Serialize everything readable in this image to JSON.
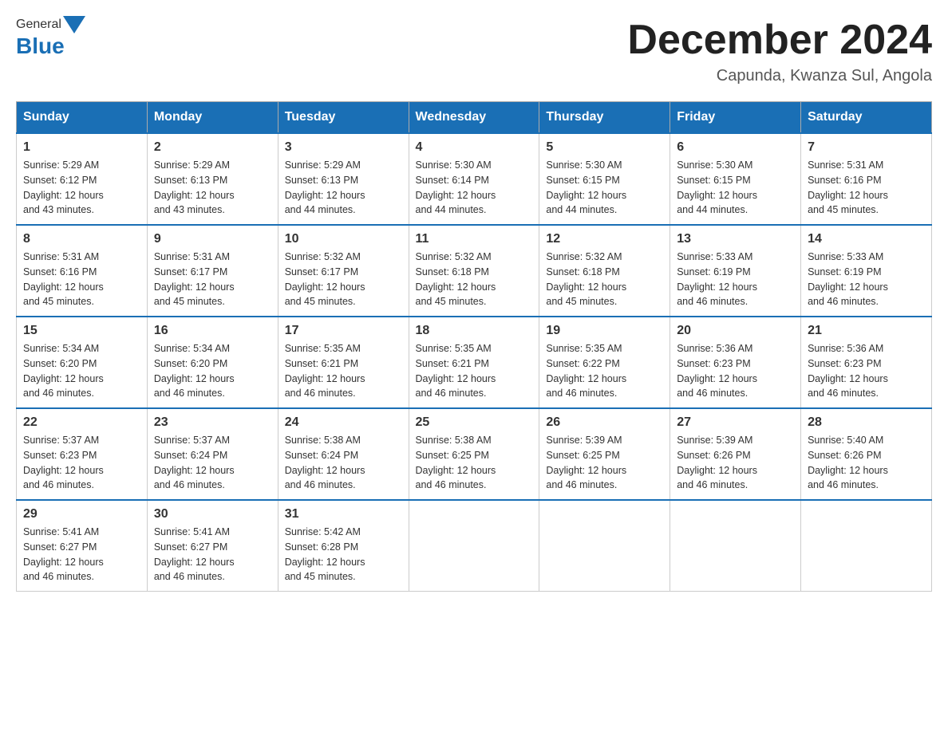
{
  "header": {
    "logo": {
      "general": "General",
      "blue": "Blue"
    },
    "title": "December 2024",
    "location": "Capunda, Kwanza Sul, Angola"
  },
  "days_of_week": [
    "Sunday",
    "Monday",
    "Tuesday",
    "Wednesday",
    "Thursday",
    "Friday",
    "Saturday"
  ],
  "weeks": [
    [
      {
        "day": "1",
        "sunrise": "5:29 AM",
        "sunset": "6:12 PM",
        "daylight": "12 hours and 43 minutes."
      },
      {
        "day": "2",
        "sunrise": "5:29 AM",
        "sunset": "6:13 PM",
        "daylight": "12 hours and 43 minutes."
      },
      {
        "day": "3",
        "sunrise": "5:29 AM",
        "sunset": "6:13 PM",
        "daylight": "12 hours and 44 minutes."
      },
      {
        "day": "4",
        "sunrise": "5:30 AM",
        "sunset": "6:14 PM",
        "daylight": "12 hours and 44 minutes."
      },
      {
        "day": "5",
        "sunrise": "5:30 AM",
        "sunset": "6:15 PM",
        "daylight": "12 hours and 44 minutes."
      },
      {
        "day": "6",
        "sunrise": "5:30 AM",
        "sunset": "6:15 PM",
        "daylight": "12 hours and 44 minutes."
      },
      {
        "day": "7",
        "sunrise": "5:31 AM",
        "sunset": "6:16 PM",
        "daylight": "12 hours and 45 minutes."
      }
    ],
    [
      {
        "day": "8",
        "sunrise": "5:31 AM",
        "sunset": "6:16 PM",
        "daylight": "12 hours and 45 minutes."
      },
      {
        "day": "9",
        "sunrise": "5:31 AM",
        "sunset": "6:17 PM",
        "daylight": "12 hours and 45 minutes."
      },
      {
        "day": "10",
        "sunrise": "5:32 AM",
        "sunset": "6:17 PM",
        "daylight": "12 hours and 45 minutes."
      },
      {
        "day": "11",
        "sunrise": "5:32 AM",
        "sunset": "6:18 PM",
        "daylight": "12 hours and 45 minutes."
      },
      {
        "day": "12",
        "sunrise": "5:32 AM",
        "sunset": "6:18 PM",
        "daylight": "12 hours and 45 minutes."
      },
      {
        "day": "13",
        "sunrise": "5:33 AM",
        "sunset": "6:19 PM",
        "daylight": "12 hours and 46 minutes."
      },
      {
        "day": "14",
        "sunrise": "5:33 AM",
        "sunset": "6:19 PM",
        "daylight": "12 hours and 46 minutes."
      }
    ],
    [
      {
        "day": "15",
        "sunrise": "5:34 AM",
        "sunset": "6:20 PM",
        "daylight": "12 hours and 46 minutes."
      },
      {
        "day": "16",
        "sunrise": "5:34 AM",
        "sunset": "6:20 PM",
        "daylight": "12 hours and 46 minutes."
      },
      {
        "day": "17",
        "sunrise": "5:35 AM",
        "sunset": "6:21 PM",
        "daylight": "12 hours and 46 minutes."
      },
      {
        "day": "18",
        "sunrise": "5:35 AM",
        "sunset": "6:21 PM",
        "daylight": "12 hours and 46 minutes."
      },
      {
        "day": "19",
        "sunrise": "5:35 AM",
        "sunset": "6:22 PM",
        "daylight": "12 hours and 46 minutes."
      },
      {
        "day": "20",
        "sunrise": "5:36 AM",
        "sunset": "6:23 PM",
        "daylight": "12 hours and 46 minutes."
      },
      {
        "day": "21",
        "sunrise": "5:36 AM",
        "sunset": "6:23 PM",
        "daylight": "12 hours and 46 minutes."
      }
    ],
    [
      {
        "day": "22",
        "sunrise": "5:37 AM",
        "sunset": "6:23 PM",
        "daylight": "12 hours and 46 minutes."
      },
      {
        "day": "23",
        "sunrise": "5:37 AM",
        "sunset": "6:24 PM",
        "daylight": "12 hours and 46 minutes."
      },
      {
        "day": "24",
        "sunrise": "5:38 AM",
        "sunset": "6:24 PM",
        "daylight": "12 hours and 46 minutes."
      },
      {
        "day": "25",
        "sunrise": "5:38 AM",
        "sunset": "6:25 PM",
        "daylight": "12 hours and 46 minutes."
      },
      {
        "day": "26",
        "sunrise": "5:39 AM",
        "sunset": "6:25 PM",
        "daylight": "12 hours and 46 minutes."
      },
      {
        "day": "27",
        "sunrise": "5:39 AM",
        "sunset": "6:26 PM",
        "daylight": "12 hours and 46 minutes."
      },
      {
        "day": "28",
        "sunrise": "5:40 AM",
        "sunset": "6:26 PM",
        "daylight": "12 hours and 46 minutes."
      }
    ],
    [
      {
        "day": "29",
        "sunrise": "5:41 AM",
        "sunset": "6:27 PM",
        "daylight": "12 hours and 46 minutes."
      },
      {
        "day": "30",
        "sunrise": "5:41 AM",
        "sunset": "6:27 PM",
        "daylight": "12 hours and 46 minutes."
      },
      {
        "day": "31",
        "sunrise": "5:42 AM",
        "sunset": "6:28 PM",
        "daylight": "12 hours and 45 minutes."
      },
      null,
      null,
      null,
      null
    ]
  ]
}
